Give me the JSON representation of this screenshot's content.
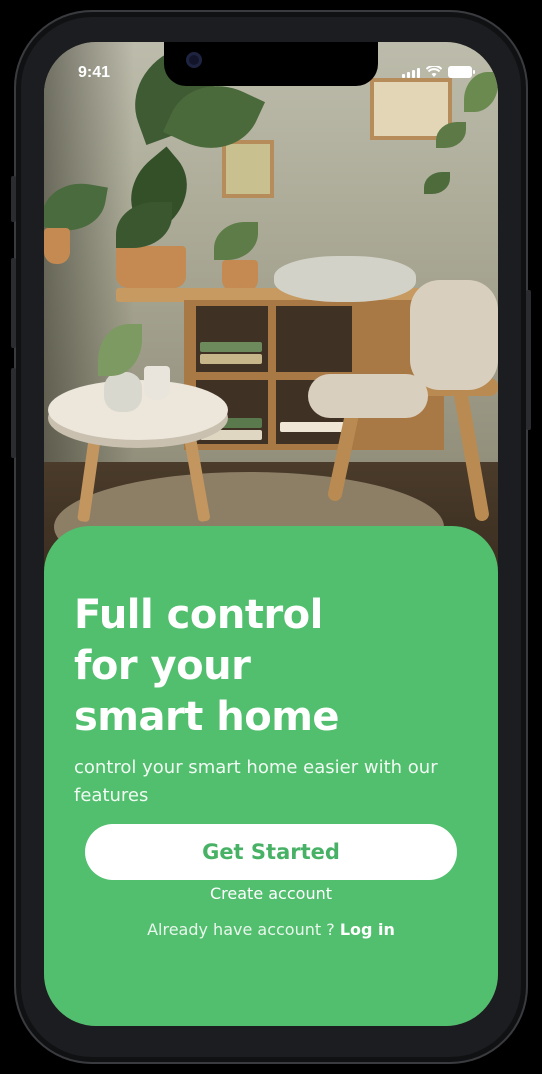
{
  "status_bar": {
    "time": "9:41",
    "icons": [
      "signal-icon",
      "wifi-icon",
      "battery-icon"
    ]
  },
  "hero": {
    "image": "living-room-with-plants-photo",
    "description_colors": {
      "wall": "#b4b3a0",
      "floor": "#3f3224"
    }
  },
  "card": {
    "background": "#51bf6e",
    "headline_lines": [
      "Full control",
      "for your",
      "smart home"
    ],
    "subtitle": "control your smart home easier with our features",
    "primary_button": {
      "label": "Get Started",
      "text_color": "#47b265"
    },
    "create_account_label": "Create account",
    "login_prompt": "Already have account ?",
    "login_link": "Log in"
  }
}
